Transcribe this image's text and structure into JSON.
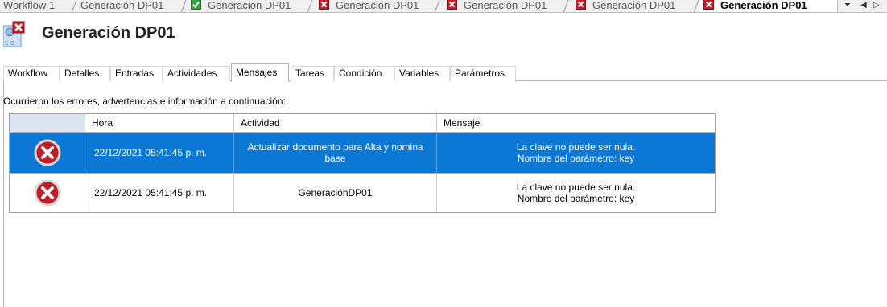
{
  "doc_tabs": [
    {
      "label": "Workflow 1",
      "status": "none"
    },
    {
      "label": "Generación DP01",
      "status": "none"
    },
    {
      "label": "Generación DP01",
      "status": "ok"
    },
    {
      "label": "Generación DP01",
      "status": "error"
    },
    {
      "label": "Generación DP01",
      "status": "error"
    },
    {
      "label": "Generación DP01",
      "status": "error"
    },
    {
      "label": "Generación DP01",
      "status": "error",
      "active": true
    }
  ],
  "header": {
    "title": "Generación DP01"
  },
  "inner_tabs": [
    {
      "label": "Workflow"
    },
    {
      "label": "Detalles"
    },
    {
      "label": "Entradas"
    },
    {
      "label": "Actividades"
    },
    {
      "label": "Mensajes",
      "active": true
    },
    {
      "label": "Tareas"
    },
    {
      "label": "Condición"
    },
    {
      "label": "Variables"
    },
    {
      "label": "Parámetros"
    }
  ],
  "intro_text": "Ocurrieron los errores, advertencias e información a continuación:",
  "grid": {
    "columns": [
      "",
      "Hora",
      "Actividad",
      "Mensaje"
    ],
    "rows": [
      {
        "icon": "error-icon",
        "hora": "22/12/2021 05:41:45 p. m.",
        "actividad": "Actualizar documento para Alta y nomina base",
        "mensaje_1": "La clave no puede ser nula.",
        "mensaje_2": "Nombre del parámetro: key",
        "selected": true
      },
      {
        "icon": "error-icon",
        "hora": "22/12/2021 05:41:45 p. m.",
        "actividad": "GeneraciónDP01",
        "mensaje_1": "La clave no puede ser nula.",
        "mensaje_2": "Nombre del parámetro: key",
        "selected": false
      }
    ]
  },
  "colors": {
    "selection": "#0c78d6",
    "error": "#c4202b",
    "ok": "#3aa341"
  }
}
